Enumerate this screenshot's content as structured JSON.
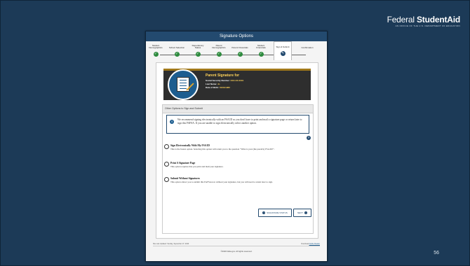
{
  "brand": {
    "title_regular": "Federal ",
    "title_bold": "StudentAid",
    "subtitle": "AN OFFICE OF THE U.S. DEPARTMENT OF EDUCATION"
  },
  "slide": {
    "page_number": "56"
  },
  "window": {
    "title": "Signature Options"
  },
  "steps": [
    {
      "label": "Student Demographics",
      "state": "done"
    },
    {
      "label": "School Selection",
      "state": "done"
    },
    {
      "label": "Dependency Status",
      "state": "done"
    },
    {
      "label": "Parent Demographics",
      "state": "done"
    },
    {
      "label": "Parent Financials",
      "state": "done"
    },
    {
      "label": "Student Financials",
      "state": "done"
    },
    {
      "label": "Sign & Submit",
      "state": "current"
    },
    {
      "label": "Confirmation",
      "state": "todo"
    }
  ],
  "hero": {
    "heading": "Parent Signature for",
    "ssn_label": "Social Security Number:",
    "ssn_value": "XXX-XX-0001",
    "last_name_label": "Last Name:",
    "last_name_value": "Jo",
    "dob_label": "Date of Birth:",
    "dob_value": "01/01/1982"
  },
  "section": {
    "heading": "Other Options to Sign and Submit"
  },
  "info": {
    "text": "We recommend signing electronically with an FSA ID so you don't have to print and mail a signature page or return later to sign this FAFSA. If you are unable to sign electronically select another option."
  },
  "options": [
    {
      "title": "Sign Electronically With My FSA ID",
      "desc": "This is the fastest option. Selecting this option will return you to the question \"What is your (the parent's) FSA ID?\"."
    },
    {
      "title": "Print A Signature Page",
      "desc": "This option requires that you print and mail your signature."
    },
    {
      "title": "Submit Without Signatures",
      "desc": "This option allows you to submit this FAFSA now without your signature, but you will need to return later to sign."
    }
  ],
  "buttons": {
    "status": "SIGNATURE STATUS",
    "next": "NEXT"
  },
  "footer": {
    "updated": "Site Last Updated: Sunday, September 27, 2020",
    "reader_text": "Download",
    "reader_link": "Adobe Reader",
    "copyright": "©2020 fafsa.gov. All rights reserved."
  }
}
